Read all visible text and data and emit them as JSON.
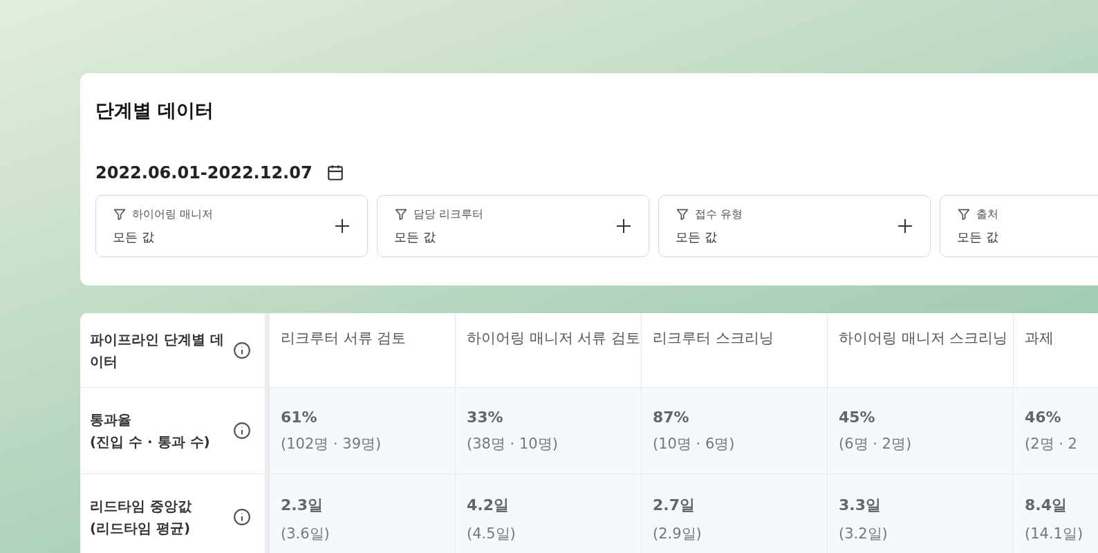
{
  "title": "단계별 데이터",
  "date_range": "2022.06.01-2022.12.07",
  "filters": [
    {
      "label": "하이어링 매니저",
      "value": "모든 값"
    },
    {
      "label": "담당 리크루터",
      "value": "모든 값"
    },
    {
      "label": "접수 유형",
      "value": "모든 값"
    },
    {
      "label": "출처",
      "value": "모든 값"
    }
  ],
  "table": {
    "header_label": "파이프라인 단계별 데이터",
    "columns": [
      "리크루터 서류 검토",
      "하이어링 매니저 서류 검토",
      "리크루터 스크리닝",
      "하이어링 매니저 스크리닝",
      "과제"
    ],
    "rows": [
      {
        "label_lines": [
          "통과율",
          "(진입 수 · 통과 수)"
        ],
        "cells": [
          {
            "main": "61%",
            "sub": "(102명 · 39명)"
          },
          {
            "main": "33%",
            "sub": "(38명 · 10명)"
          },
          {
            "main": "87%",
            "sub": "(10명 · 6명)"
          },
          {
            "main": "45%",
            "sub": "(6명 · 2명)"
          },
          {
            "main": "46%",
            "sub": "(2명 · 2"
          }
        ]
      },
      {
        "label_lines": [
          "리드타임 중앙값",
          "(리드타임 평균)"
        ],
        "cells": [
          {
            "main": "2.3일",
            "sub": "(3.6일)"
          },
          {
            "main": "4.2일",
            "sub": "(4.5일)"
          },
          {
            "main": "2.7일",
            "sub": "(2.9일)"
          },
          {
            "main": "3.3일",
            "sub": "(3.2일)"
          },
          {
            "main": "8.4일",
            "sub": "(14.1일)"
          }
        ]
      }
    ]
  }
}
